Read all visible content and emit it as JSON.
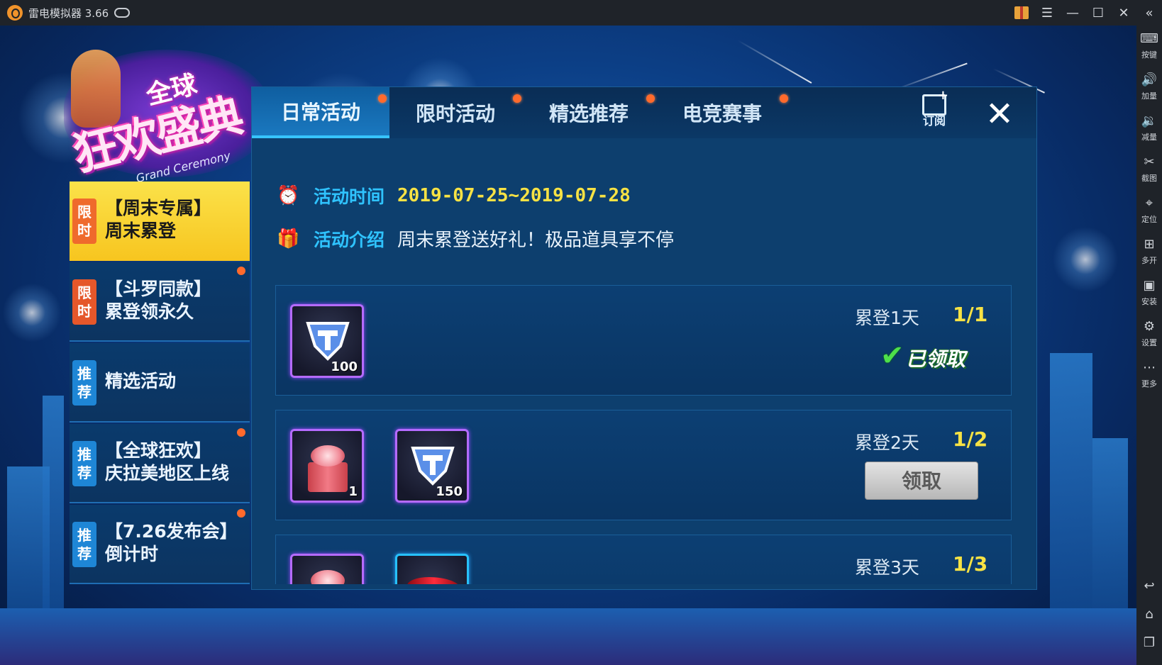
{
  "titlebar": {
    "app_title": "雷电模拟器 3.66"
  },
  "right_toolbar": {
    "items": [
      {
        "label": "按键",
        "icon": "keyboard-icon"
      },
      {
        "label": "加量",
        "icon": "volume-up-icon"
      },
      {
        "label": "减量",
        "icon": "volume-down-icon"
      },
      {
        "label": "截图",
        "icon": "scissors-icon"
      },
      {
        "label": "定位",
        "icon": "location-pin-icon"
      },
      {
        "label": "多开",
        "icon": "multi-instance-icon"
      },
      {
        "label": "安装",
        "icon": "apk-install-icon"
      },
      {
        "label": "设置",
        "icon": "gear-icon"
      },
      {
        "label": "更多",
        "icon": "more-dots-icon"
      }
    ],
    "bottom_icons": [
      "back-icon",
      "home-icon",
      "recent-apps-icon"
    ]
  },
  "logo": {
    "small_text": "全球",
    "main_text": "狂欢盛典",
    "sub_text": "Grand Ceremony"
  },
  "tabs": [
    {
      "label": "日常活动",
      "active": true,
      "dot": true
    },
    {
      "label": "限时活动",
      "active": false,
      "dot": true
    },
    {
      "label": "精选推荐",
      "active": false,
      "dot": true
    },
    {
      "label": "电竞赛事",
      "active": false,
      "dot": true
    }
  ],
  "subscribe_label": "订阅",
  "menu": [
    {
      "tag": "限时",
      "tag_type": "limited",
      "lines": [
        "【周末专属】",
        "周末累登"
      ],
      "active": true,
      "dot": false
    },
    {
      "tag": "限时",
      "tag_type": "limited",
      "lines": [
        "【斗罗同款】",
        "累登领永久"
      ],
      "active": false,
      "dot": true
    },
    {
      "tag": "推荐",
      "tag_type": "recommend",
      "lines": [
        "精选活动"
      ],
      "active": false,
      "dot": false
    },
    {
      "tag": "推荐",
      "tag_type": "recommend",
      "lines": [
        "【全球狂欢】",
        "庆拉美地区上线"
      ],
      "active": false,
      "dot": true
    },
    {
      "tag": "推荐",
      "tag_type": "recommend",
      "lines": [
        "【7.26发布会】",
        "倒计时"
      ],
      "active": false,
      "dot": true
    }
  ],
  "activity": {
    "time_label": "活动时间",
    "time_value": "2019-07-25~2019-07-28",
    "intro_label": "活动介绍",
    "intro_value": "周末累登送好礼！极品道具享不停"
  },
  "rewards": [
    {
      "day_label": "累登1天",
      "progress": "1/1",
      "status": "claimed",
      "status_text": "已领取",
      "items": [
        {
          "type": "t-coin",
          "count": "100"
        }
      ]
    },
    {
      "day_label": "累登2天",
      "progress": "1/2",
      "status": "claim",
      "status_text": "领取",
      "items": [
        {
          "type": "gift-box",
          "count": "1"
        },
        {
          "type": "t-coin",
          "count": "150"
        }
      ]
    },
    {
      "day_label": "累登3天",
      "progress": "1/3",
      "status": "pending",
      "status_text": "",
      "items": [
        {
          "type": "gift-box",
          "count": ""
        },
        {
          "type": "car",
          "count": ""
        }
      ]
    }
  ],
  "colors": {
    "accent_cyan": "#2fc3ff",
    "date_yellow": "#f7e244",
    "tab_dot": "#ff6a2c",
    "active_menu": "#f7c51f"
  }
}
